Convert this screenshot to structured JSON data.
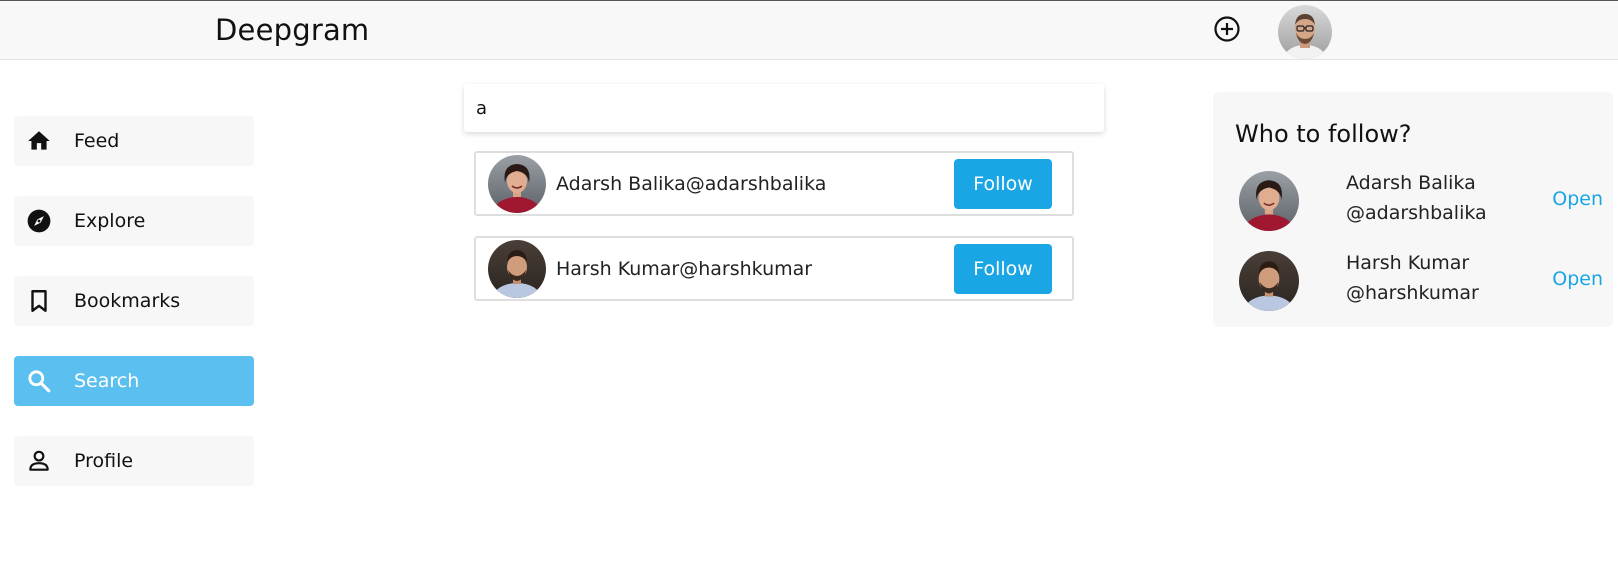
{
  "header": {
    "brand": "Deepgram",
    "add_icon": "plus-circle-icon",
    "avatar_icon": "user-avatar"
  },
  "sidebar": {
    "items": [
      {
        "label": "Feed",
        "icon": "home-icon"
      },
      {
        "label": "Explore",
        "icon": "compass-icon"
      },
      {
        "label": "Bookmarks",
        "icon": "bookmark-icon"
      },
      {
        "label": "Search",
        "icon": "search-icon",
        "active": true
      },
      {
        "label": "Profile",
        "icon": "person-icon"
      }
    ],
    "active_color": "#5bc0ef"
  },
  "search": {
    "value": "a",
    "results": [
      {
        "name": "Adarsh Balika@adarshbalika",
        "button": "Follow"
      },
      {
        "name": "Harsh Kumar@harshkumar",
        "button": "Follow"
      }
    ],
    "button_color": "#1aa6e4"
  },
  "who_to_follow": {
    "title": "Who to follow?",
    "users": [
      {
        "name": "Adarsh Balika",
        "handle": "@adarshbalika",
        "action": "Open"
      },
      {
        "name": "Harsh Kumar",
        "handle": "@harshkumar",
        "action": "Open"
      }
    ]
  }
}
